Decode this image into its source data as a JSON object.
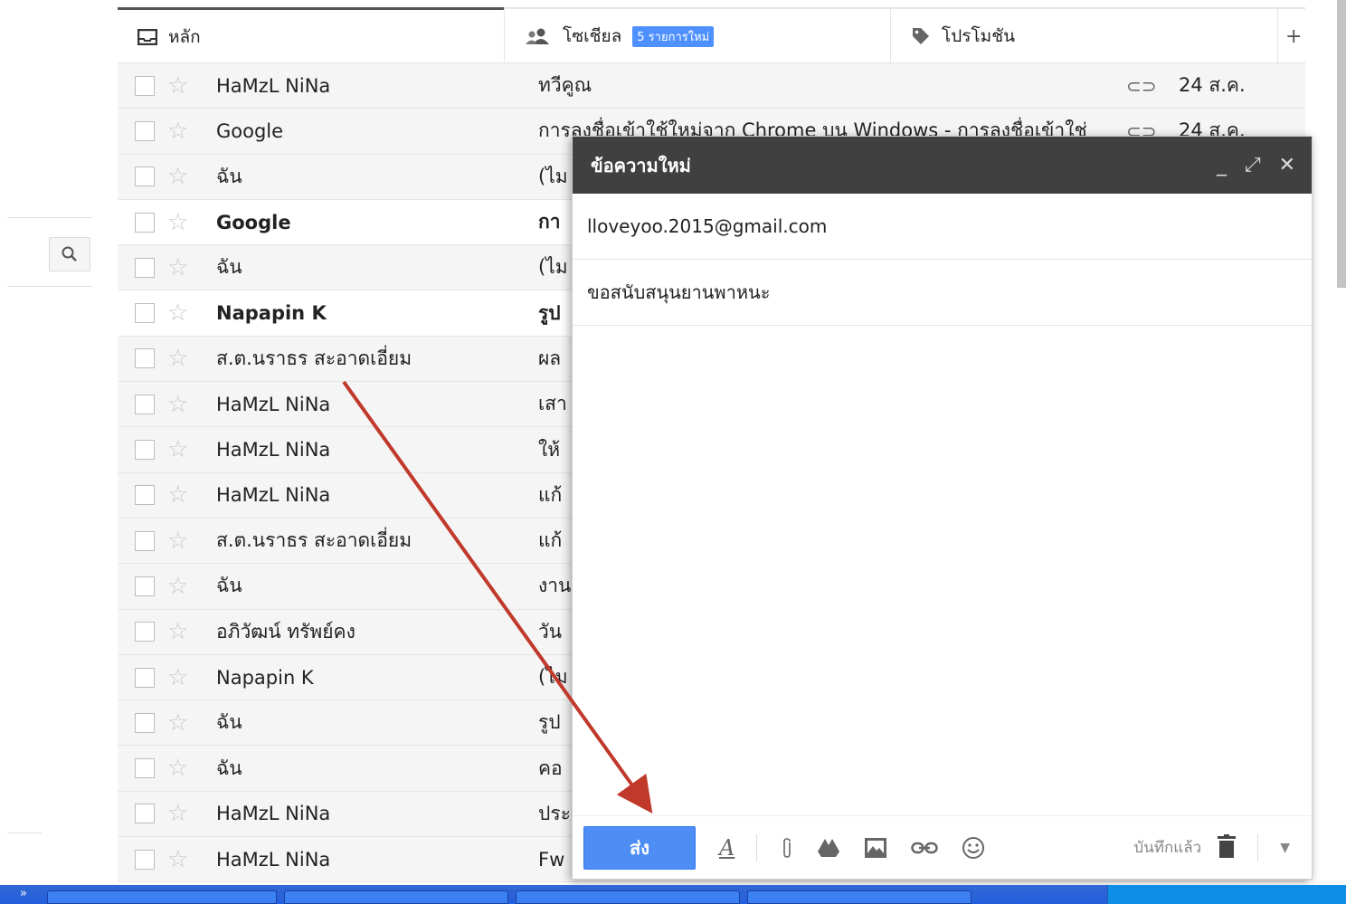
{
  "tabs": [
    {
      "label": "หลัก",
      "icon": "inbox-icon"
    },
    {
      "label": "โซเชียล",
      "icon": "people-icon",
      "badge": "5 รายการใหม่"
    },
    {
      "label": "โปรโมชัน",
      "icon": "tag-icon"
    },
    {
      "label": "+"
    }
  ],
  "rows": [
    {
      "sender": "HaMzL NiNa",
      "subject": "ทวีคูณ",
      "attachment": true,
      "date": "24 ส.ค."
    },
    {
      "sender": "Google",
      "subject": "การลงชื่อเข้าใช้ใหม่จาก Chrome บน Windows - การลงชื่อเข้าใช่",
      "attachment": true,
      "date": "24 ส.ค."
    },
    {
      "sender": "ฉัน",
      "subject": "(ไม"
    },
    {
      "sender": "Google",
      "subject": "กา",
      "unread": true
    },
    {
      "sender": "ฉัน",
      "subject": "(ไม"
    },
    {
      "sender": "Napapin K",
      "subject": "รูป",
      "unread": true
    },
    {
      "sender": "ส.ต.นราธร สะอาดเอี่ยม",
      "subject": "ผล"
    },
    {
      "sender": "HaMzL NiNa",
      "subject": "เสา"
    },
    {
      "sender": "HaMzL NiNa",
      "subject": "ให้"
    },
    {
      "sender": "HaMzL NiNa",
      "subject": "แก้"
    },
    {
      "sender": "ส.ต.นราธร สะอาดเอี่ยม",
      "subject": "แก้"
    },
    {
      "sender": "ฉัน",
      "subject": "งาน"
    },
    {
      "sender": "อภิวัฒน์ ทรัพย์คง",
      "subject": "วัน"
    },
    {
      "sender": "Napapin K",
      "subject": "(ไม"
    },
    {
      "sender": "ฉัน",
      "subject": "รูป"
    },
    {
      "sender": "ฉัน",
      "subject": "คอ"
    },
    {
      "sender": "HaMzL NiNa",
      "subject": "ประ"
    },
    {
      "sender": "HaMzL NiNa",
      "subject": "Fw"
    }
  ],
  "compose": {
    "title": "ข้อความใหม่",
    "to": "lloveyoo.2015@gmail.com",
    "subject": "ขอสนับสนุนยานพาหนะ",
    "send_label": "ส่ง",
    "saved_label": "บันทึกแล้ว"
  },
  "colors": {
    "accent": "#4d90fe",
    "arrow": "#c0392b",
    "header": "#404040"
  }
}
